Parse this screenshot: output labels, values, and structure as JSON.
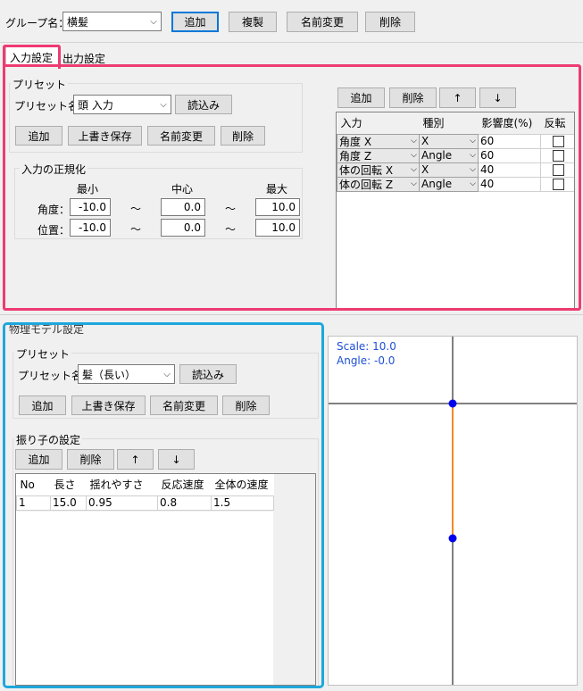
{
  "group": {
    "label": "グループ名：",
    "value": "横髪",
    "buttons": {
      "add": "追加",
      "copy": "複製",
      "rename": "名前変更",
      "delete": "削除"
    }
  },
  "tabs": [
    {
      "label": "入力設定",
      "active": true
    },
    {
      "label": "出力設定",
      "active": false
    }
  ],
  "input_preset": {
    "title": "プリセット",
    "name_label": "プリセット名：",
    "name_value": "頭 入力",
    "load": "読込み",
    "add": "追加",
    "overwrite": "上書き保存",
    "rename": "名前変更",
    "delete": "削除"
  },
  "normalize": {
    "title": "入力の正規化",
    "col_min": "最小",
    "col_center": "中心",
    "col_max": "最大",
    "tilde": "～",
    "rows": [
      {
        "label": "角度：",
        "min": "-10.0",
        "center": "0.0",
        "max": "10.0"
      },
      {
        "label": "位置：",
        "min": "-10.0",
        "center": "0.0",
        "max": "10.0"
      }
    ]
  },
  "input_list": {
    "buttons": {
      "add": "追加",
      "delete": "削除",
      "up": "↑",
      "down": "↓"
    },
    "headers": [
      "入力",
      "種別",
      "影響度(%)",
      "反転"
    ],
    "rows": [
      {
        "input": "角度 X",
        "type": "X",
        "influence": "60",
        "invert": false
      },
      {
        "input": "角度 Z",
        "type": "Angle",
        "influence": "60",
        "invert": false
      },
      {
        "input": "体の回転 X",
        "type": "X",
        "influence": "40",
        "invert": false
      },
      {
        "input": "体の回転 Z",
        "type": "Angle",
        "influence": "40",
        "invert": false
      }
    ]
  },
  "physics": {
    "title": "物理モデル設定",
    "preset_title": "プリセット",
    "name_label": "プリセット名：",
    "name_value": "髪（長い）",
    "load": "読込み",
    "add": "追加",
    "overwrite": "上書き保存",
    "rename": "名前変更",
    "delete": "削除",
    "pendulum_title": "振り子の設定",
    "p_add": "追加",
    "p_delete": "削除",
    "p_up": "↑",
    "p_down": "↓",
    "headers": [
      "No",
      "長さ",
      "揺れやすさ",
      "反応速度",
      "全体の速度"
    ],
    "rows": [
      {
        "no": "1",
        "length": "15.0",
        "sway": "0.95",
        "response": "0.8",
        "speed": "1.5"
      }
    ]
  },
  "preview": {
    "scale_text": "Scale: 10.0",
    "angle_text": "Angle: -0.0",
    "colors": {
      "text": "#1f4fd6",
      "axis": "#000000",
      "rod": "#f08a2a",
      "joint": "#0000ee"
    }
  },
  "highlight_colors": {
    "pink": "#ee3a72",
    "blue": "#1ea7dc"
  }
}
